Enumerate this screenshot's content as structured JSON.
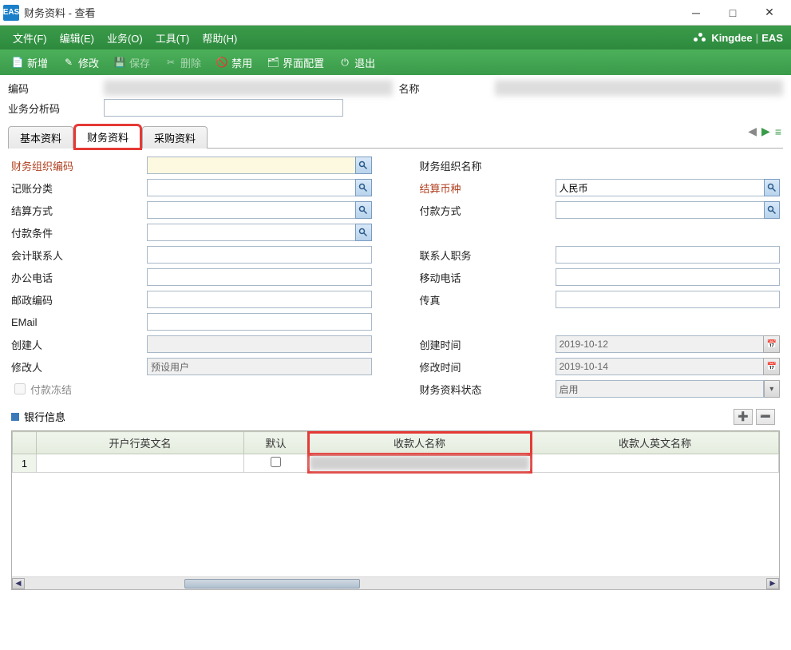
{
  "window": {
    "title": "财务资料 - 查看"
  },
  "menu": {
    "file": "文件(F)",
    "edit": "编辑(E)",
    "biz": "业务(O)",
    "tool": "工具(T)",
    "help": "帮助(H)"
  },
  "brand": {
    "name": "Kingdee",
    "sub": "EAS"
  },
  "toolbar": {
    "new": "新增",
    "modify": "修改",
    "save": "保存",
    "delete": "删除",
    "disable": "禁用",
    "layout": "界面配置",
    "exit": "退出"
  },
  "header": {
    "code_label": "编码",
    "name_label": "名称",
    "analysis_label": "业务分析码"
  },
  "tabs": {
    "basic": "基本资料",
    "finance": "财务资料",
    "purchase": "采购资料"
  },
  "fields": {
    "fin_org_code": "财务组织编码",
    "fin_org_name": "财务组织名称",
    "acct_class": "记账分类",
    "settle_currency": "结算币种",
    "settle_method": "结算方式",
    "pay_method": "付款方式",
    "pay_cond": "付款条件",
    "acct_contact": "会计联系人",
    "contact_title": "联系人职务",
    "office_tel": "办公电话",
    "mobile": "移动电话",
    "postcode": "邮政编码",
    "fax": "传真",
    "email": "EMail",
    "creator": "创建人",
    "create_time": "创建时间",
    "modifier": "修改人",
    "modify_time": "修改时间",
    "pay_freeze": "付款冻结",
    "fin_status": "财务资料状态"
  },
  "values": {
    "settle_currency": "人民币",
    "creator": "",
    "modifier": "预设用户",
    "create_time": "2019-10-12",
    "modify_time": "2019-10-14",
    "fin_status": "启用"
  },
  "section": {
    "bank": "银行信息"
  },
  "grid": {
    "cols": {
      "bank_en": "开户行英文名",
      "default": "默认",
      "payee": "收款人名称",
      "payee_en": "收款人英文名称"
    },
    "row1": "1"
  }
}
